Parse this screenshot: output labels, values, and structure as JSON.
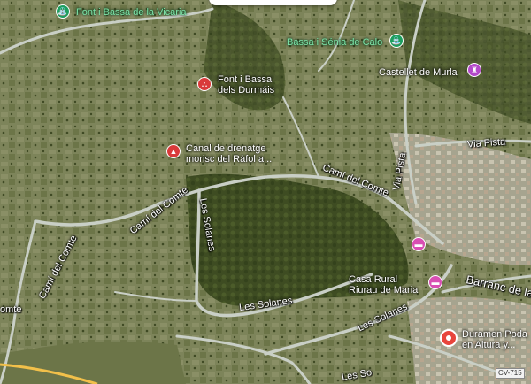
{
  "map": {
    "type": "satellite",
    "colors": {
      "terrain": "#5f6b3e",
      "road": "#c9cfc6",
      "accent_pin": "#e8453c"
    },
    "road_labels": [
      {
        "id": "cami-del-comte-1",
        "text": "Camí del Comte"
      },
      {
        "id": "cami-del-comte-2",
        "text": "Camí del Comte"
      },
      {
        "id": "cami-del-comte-3",
        "text": "Camí del Comte"
      },
      {
        "id": "cami-del-comte-4",
        "text": "omte"
      },
      {
        "id": "les-solanes-1",
        "text": "Les Solanes"
      },
      {
        "id": "les-solanes-2",
        "text": "Les Solanes"
      },
      {
        "id": "les-solanes-3",
        "text": "Les Solanes"
      },
      {
        "id": "les-solanes-4",
        "text": "Les So"
      },
      {
        "id": "via-pista-1",
        "text": "Via Pista"
      },
      {
        "id": "via-pista-2",
        "text": "Via Pista"
      },
      {
        "id": "barranc",
        "text": "Barranc de la"
      }
    ],
    "road_shield": "CV-715",
    "pois": [
      {
        "id": "font-vicaria",
        "label": "Font i Bassa de la Vicaria",
        "icon": "fountain-icon",
        "color": "green"
      },
      {
        "id": "bassa-senia",
        "label": "Bassa i Sénia de Calo",
        "icon": "fountain-icon",
        "color": "green"
      },
      {
        "id": "font-durmais",
        "label": "Font i Bassa\ndels Durmáis",
        "icon": "landmark-icon",
        "color": "red"
      },
      {
        "id": "canal",
        "label": "Canal de drenatge\nmorisc del Ràfol a...",
        "icon": "monument-icon",
        "color": "red"
      },
      {
        "id": "castellet",
        "label": "Castellet de Murla",
        "icon": "castle-icon",
        "color": "purple"
      },
      {
        "id": "hotel-1",
        "label": "",
        "icon": "hotel-icon",
        "color": "pink"
      },
      {
        "id": "casa-rural",
        "label": "Casa Rural\nRiurau de Maria",
        "icon": "hotel-icon",
        "color": "pink"
      },
      {
        "id": "duramen",
        "label": "Duramen Poda\nen Altura y...",
        "icon": "location-pin-icon",
        "color": "red"
      }
    ]
  }
}
